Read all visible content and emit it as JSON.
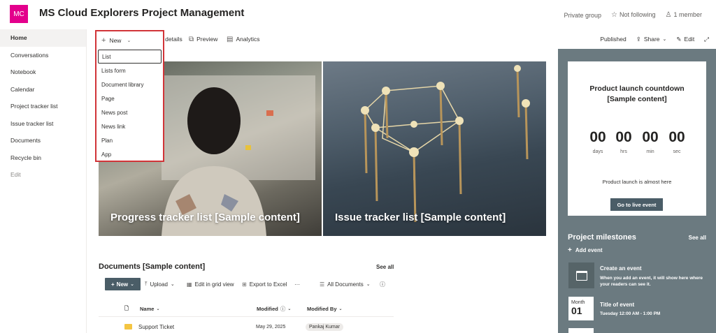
{
  "header": {
    "logo_text": "MC",
    "site_title": "MS Cloud Explorers Project Management",
    "private_group": "Private group",
    "follow": "Not following",
    "members": "1 member"
  },
  "nav": {
    "items": [
      "Home",
      "Conversations",
      "Notebook",
      "Calendar",
      "Project tracker list",
      "Issue tracker list",
      "Documents",
      "Recycle bin",
      "Edit"
    ]
  },
  "cmdbar": {
    "new": "New",
    "page_details": "Page details",
    "preview": "Preview",
    "analytics": "Analytics",
    "published": "Published",
    "share": "Share",
    "edit": "Edit"
  },
  "new_menu": {
    "items": [
      "List",
      "Lists form",
      "Document library",
      "Page",
      "News post",
      "News link",
      "Plan",
      "App"
    ]
  },
  "hero": {
    "left_caption": "Progress tracker list [Sample content]",
    "right_caption": "Issue tracker list [Sample content]"
  },
  "documents": {
    "title": "Documents [Sample content]",
    "see_all": "See all",
    "toolbar": {
      "new": "New",
      "upload": "Upload",
      "edit_grid": "Edit in grid view",
      "export": "Export to Excel",
      "more": "···",
      "view": "All Documents"
    },
    "columns": {
      "name": "Name",
      "modified": "Modified",
      "modified_by": "Modified By"
    },
    "rows": [
      {
        "name": "Support Ticket",
        "modified": "May 29, 2025",
        "modified_by": "Pankaj Kumar"
      }
    ]
  },
  "countdown": {
    "title_line1": "Product launch countdown",
    "title_line2": "[Sample content]",
    "days": "00",
    "hrs": "00",
    "min": "00",
    "sec": "00",
    "days_lbl": "days",
    "hrs_lbl": "hrs",
    "min_lbl": "min",
    "sec_lbl": "sec",
    "note": "Product launch is almost here",
    "button": "Go to live event"
  },
  "milestones": {
    "title": "Project milestones",
    "see_all": "See all",
    "add_event": "Add event",
    "event1_title": "Create an event",
    "event1_desc": "When you add an event, it will show here where your readers can see it.",
    "month_label": "Month",
    "month_day": "01",
    "event2_title": "Title of event",
    "event2_time": "Tuesday 12:00 AM - 1:00 PM"
  },
  "colors": {
    "brand_logo": "#e3008c",
    "panel": "#6b7a80",
    "button": "#4a5d67",
    "highlight_border": "#d13438"
  }
}
